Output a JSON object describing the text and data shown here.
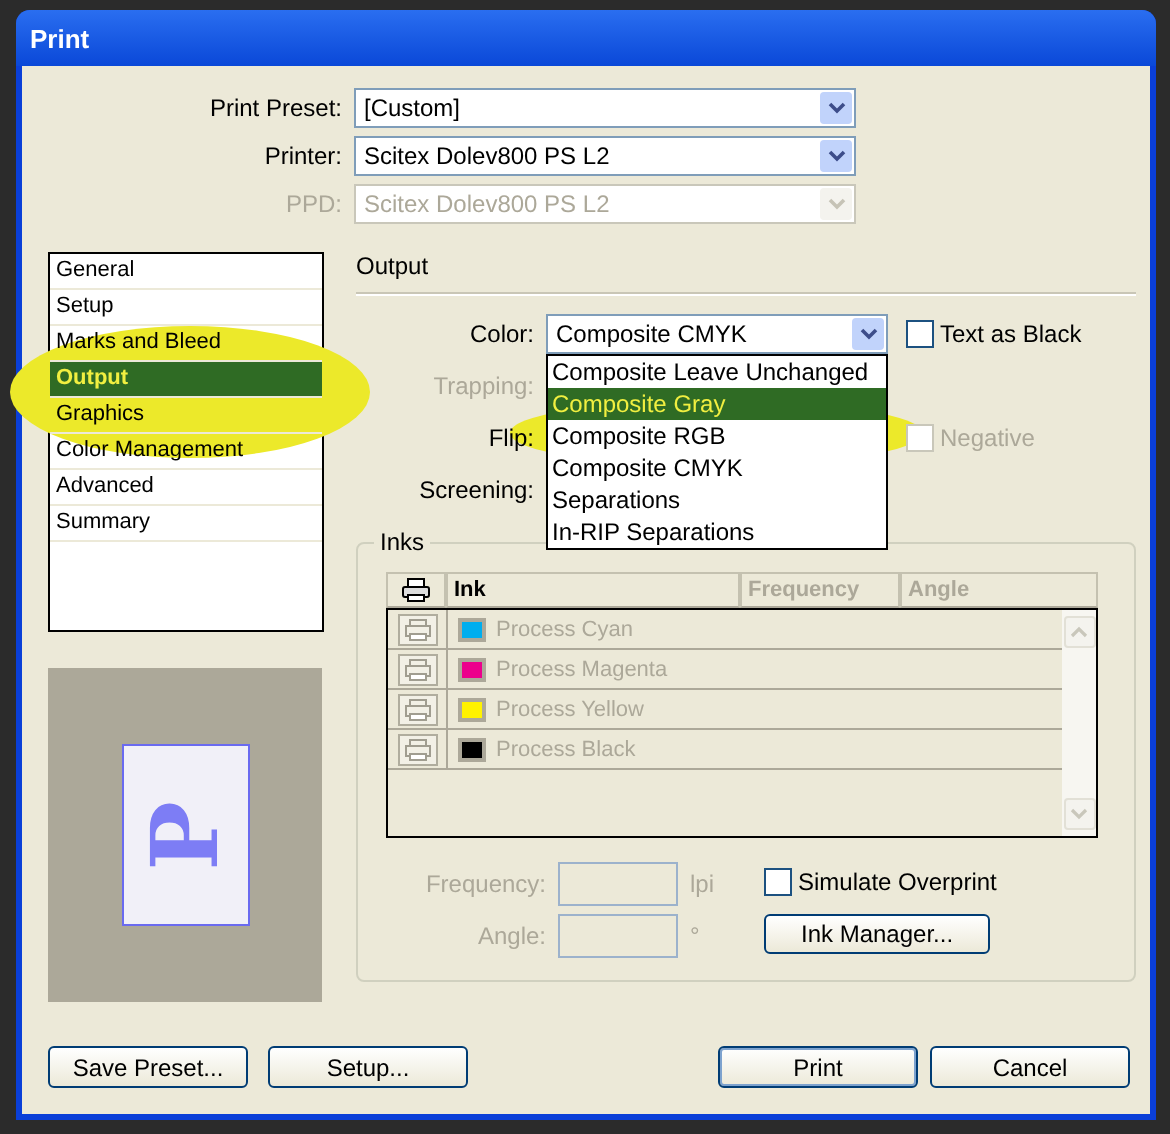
{
  "window": {
    "title": "Print"
  },
  "top_fields": [
    {
      "label": "Print Preset:",
      "value": "[Custom]",
      "disabled": false
    },
    {
      "label": "Printer:",
      "value": "Scitex Dolev800 PS L2",
      "disabled": false
    },
    {
      "label": "PPD:",
      "value": "Scitex Dolev800 PS L2",
      "disabled": true
    }
  ],
  "sidebar": {
    "items": [
      {
        "label": "General",
        "selected": false
      },
      {
        "label": "Setup",
        "selected": false
      },
      {
        "label": "Marks and Bleed",
        "selected": false
      },
      {
        "label": "Output",
        "selected": true
      },
      {
        "label": "Graphics",
        "selected": false
      },
      {
        "label": "Color Management",
        "selected": false
      },
      {
        "label": "Advanced",
        "selected": false
      },
      {
        "label": "Summary",
        "selected": false
      }
    ]
  },
  "preview": {
    "glyph": "P"
  },
  "section_title": "Output",
  "output": {
    "color": {
      "label": "Color:",
      "value": "Composite CMYK",
      "expanded": true,
      "options": [
        {
          "label": "Composite Leave Unchanged",
          "highlighted": false
        },
        {
          "label": "Composite Gray",
          "highlighted": true
        },
        {
          "label": "Composite RGB",
          "highlighted": false
        },
        {
          "label": "Composite CMYK",
          "highlighted": false
        },
        {
          "label": "Separations",
          "highlighted": false
        },
        {
          "label": "In-RIP Separations",
          "highlighted": false
        }
      ]
    },
    "text_as_black": {
      "label": "Text as Black",
      "checked": false
    },
    "trapping": {
      "label": "Trapping:",
      "disabled": true
    },
    "flip": {
      "label": "Flip:",
      "disabled": false
    },
    "negative": {
      "label": "Negative",
      "checked": false,
      "disabled": true
    },
    "screening": {
      "label": "Screening:",
      "disabled": false
    }
  },
  "inks": {
    "title": "Inks",
    "columns": [
      {
        "label": "Ink",
        "disabled": false
      },
      {
        "label": "Frequency",
        "disabled": true
      },
      {
        "label": "Angle",
        "disabled": true
      }
    ],
    "rows": [
      {
        "name": "Process Cyan",
        "color": "#00aeef"
      },
      {
        "name": "Process Magenta",
        "color": "#ec008c"
      },
      {
        "name": "Process Yellow",
        "color": "#fff200"
      },
      {
        "name": "Process Black",
        "color": "#000000"
      }
    ]
  },
  "frequency": {
    "label": "Frequency:",
    "unit": "lpi"
  },
  "angle": {
    "label": "Angle:",
    "unit": "°"
  },
  "simulate_overprint": {
    "label": "Simulate Overprint",
    "checked": false
  },
  "ink_manager_button": "Ink Manager...",
  "buttons": [
    {
      "label": "Save Preset...",
      "default": false
    },
    {
      "label": "Setup...",
      "default": false
    },
    {
      "label": "Print",
      "default": true
    },
    {
      "label": "Cancel",
      "default": false
    }
  ]
}
